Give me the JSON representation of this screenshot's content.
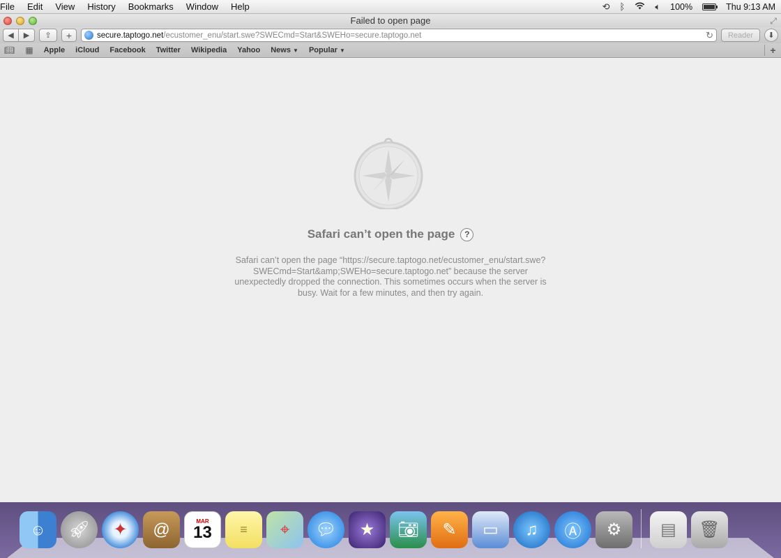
{
  "menubar": {
    "items": [
      "File",
      "Edit",
      "View",
      "History",
      "Bookmarks",
      "Window",
      "Help"
    ],
    "battery": "100%",
    "clock": "Thu 9:13 AM",
    "battery_level": 1.0
  },
  "window": {
    "title": "Failed to open page",
    "url_host": "secure.taptogo.net",
    "url_path": "/ecustomer_enu/start.swe?SWECmd=Start&SWEHo=secure.taptogo.net",
    "reader_label": "Reader"
  },
  "bookmarks": {
    "items": [
      "Apple",
      "iCloud",
      "Facebook",
      "Twitter",
      "Wikipedia",
      "Yahoo",
      "News",
      "Popular"
    ]
  },
  "error": {
    "title": "Safari can’t open the page",
    "help_label": "?",
    "message": "Safari can’t open the page “https://secure.taptogo.net/ecustomer_enu/start.swe?SWECmd=Start&amp;SWEHo=secure.taptogo.net” because the server unexpectedly dropped the connection. This sometimes occurs when the server is busy. Wait for a few minutes, and then try again."
  },
  "dock": {
    "calendar_month": "MAR",
    "calendar_day": "13",
    "apps": [
      "finder",
      "launchpad",
      "safari",
      "contacts",
      "calendar",
      "notes",
      "maps",
      "messages",
      "imovie",
      "iphoto",
      "pages",
      "keynote",
      "itunes",
      "app-store",
      "system-preferences",
      "downloads",
      "trash"
    ]
  },
  "colors": {
    "accent": "#2b73c8",
    "dock_bg": "#6b5a8a"
  }
}
